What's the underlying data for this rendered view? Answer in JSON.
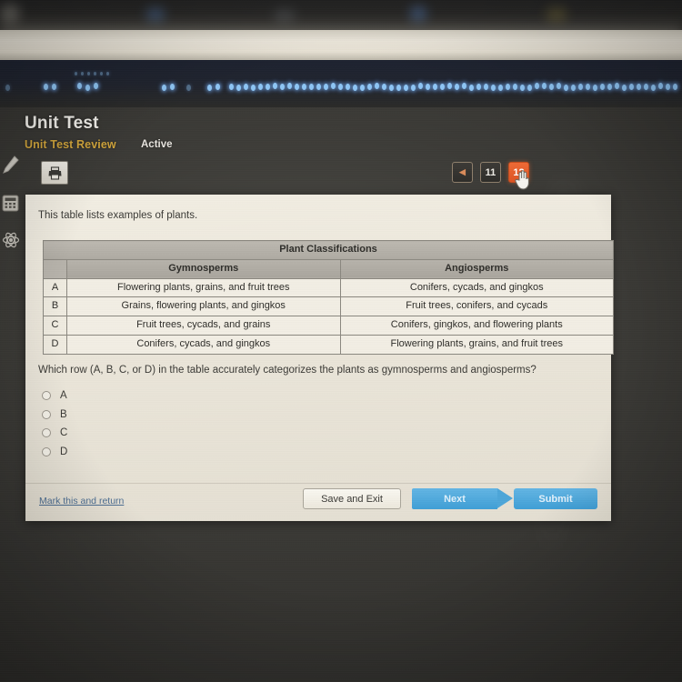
{
  "header": {
    "title": "Unit Test",
    "lesson_name": "Unit Test Review",
    "status": "Active",
    "print_icon": "printer-icon"
  },
  "pagination": {
    "prev_label": "◀",
    "pages": [
      {
        "label": "11",
        "current": false
      },
      {
        "label": "12",
        "current": true
      }
    ],
    "cursor": "hand-cursor",
    "current_accent": "#ef6a35"
  },
  "tool_rail": {
    "items": [
      {
        "icon": "highlighter-icon",
        "label": "Highlighter"
      },
      {
        "icon": "calculator-icon",
        "label": "Calculator"
      },
      {
        "icon": "atom-icon",
        "label": "Periodic Table"
      }
    ]
  },
  "content": {
    "intro_text": "This table lists examples of plants.",
    "question_text": "Which row (A, B, C, or D) in the table accurately categorizes the plants as gymnosperms and angiosperms?",
    "table": {
      "title": "Plant Classifications",
      "columns": [
        "Gymnosperms",
        "Angiosperms"
      ],
      "rows": [
        {
          "label": "A",
          "gymnosperms": "Flowering plants, grains, and fruit trees",
          "angiosperms": "Conifers, cycads, and gingkos"
        },
        {
          "label": "B",
          "gymnosperms": "Grains, flowering plants, and gingkos",
          "angiosperms": "Fruit trees, conifers, and cycads"
        },
        {
          "label": "C",
          "gymnosperms": "Fruit trees, cycads, and grains",
          "angiosperms": "Conifers, gingkos, and flowering plants"
        },
        {
          "label": "D",
          "gymnosperms": "Conifers, cycads, and gingkos",
          "angiosperms": "Flowering plants, grains, and fruit trees"
        }
      ]
    },
    "options": [
      {
        "label": "A",
        "selected": false
      },
      {
        "label": "B",
        "selected": false
      },
      {
        "label": "C",
        "selected": false
      },
      {
        "label": "D",
        "selected": false
      }
    ]
  },
  "footer": {
    "mark_return_label": "Mark this and return",
    "save_exit_label": "Save and Exit",
    "next_label": "Next",
    "submit_label": "Submit",
    "button_accent": "#4da6d9"
  }
}
